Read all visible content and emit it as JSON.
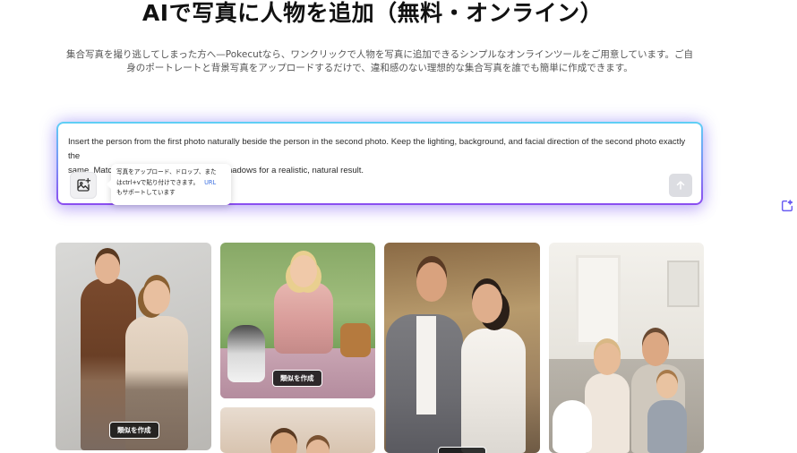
{
  "header": {
    "title": "AIで写真に人物を追加（無料・オンライン）",
    "intro_line1": "集合写真を撮り逃してしまった方へ—Pokecutなら、ワンクリックで人物を写真に追加できるシンプルなオンラインツールをご用意しています。ご自",
    "intro_line2": "身のポートレートと背景写真をアップロードするだけで、違和感のない理想的な集合写真を誰でも簡単に作成できます。"
  },
  "prompt": {
    "line1": "Insert the person from the first photo naturally beside the person in the second photo. Keep the lighting, background, and facial direction of the second photo exactly the",
    "line2": "same. Match body scale, color tone, and shadows for a realistic, natural result."
  },
  "upload_tooltip": {
    "line1": "写真をアップロード、ドロップ、また",
    "line2": "はctrl+vで貼り付けできます。",
    "url_label": "URL",
    "line3": "もサポートしています"
  },
  "icons": {
    "upload": "image-plus-icon",
    "send": "arrow-up-icon",
    "side": "edit-square-icon"
  },
  "gallery": {
    "make_similar_label": "類似を作成"
  },
  "colors": {
    "accent_purple": "#8b4df0",
    "accent_cyan": "#5fd0f5"
  }
}
